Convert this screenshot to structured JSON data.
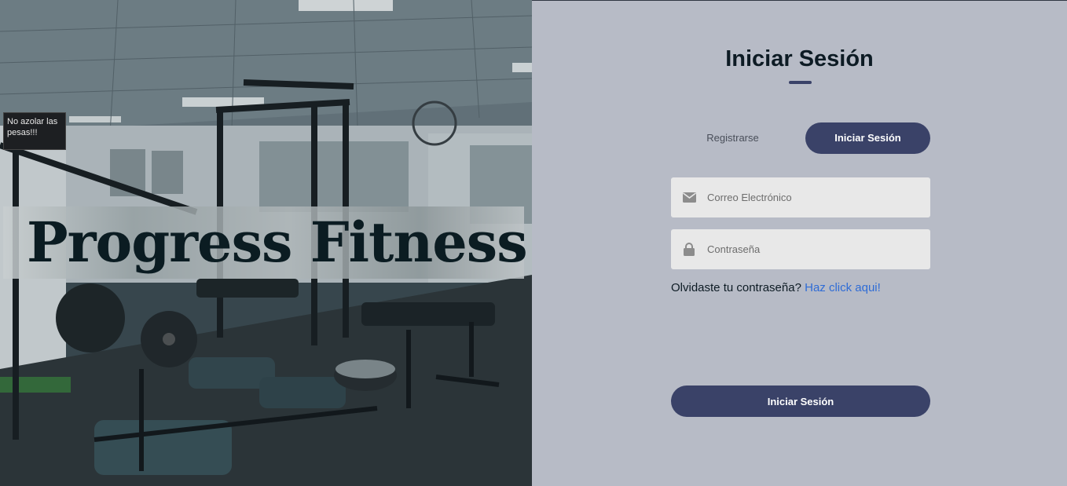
{
  "hero": {
    "brand": "Progress Fitness",
    "sign_text": "No azolar las pesas!!!"
  },
  "form": {
    "title": "Iniciar Sesión",
    "tabs": {
      "register_label": "Registrarse",
      "login_label": "Iniciar Sesión"
    },
    "email": {
      "placeholder": "Correo Electrónico",
      "icon": "envelope-icon"
    },
    "password": {
      "placeholder": "Contraseña",
      "icon": "lock-icon"
    },
    "forgot": {
      "text": "Olvidaste tu contraseña?",
      "link_label": "Haz click aqui!"
    },
    "submit_label": "Iniciar Sesión"
  },
  "colors": {
    "panel_bg": "#b7bbc6",
    "accent": "#3a4268",
    "link": "#2f6cd6",
    "field_bg": "#e8e8e8"
  }
}
